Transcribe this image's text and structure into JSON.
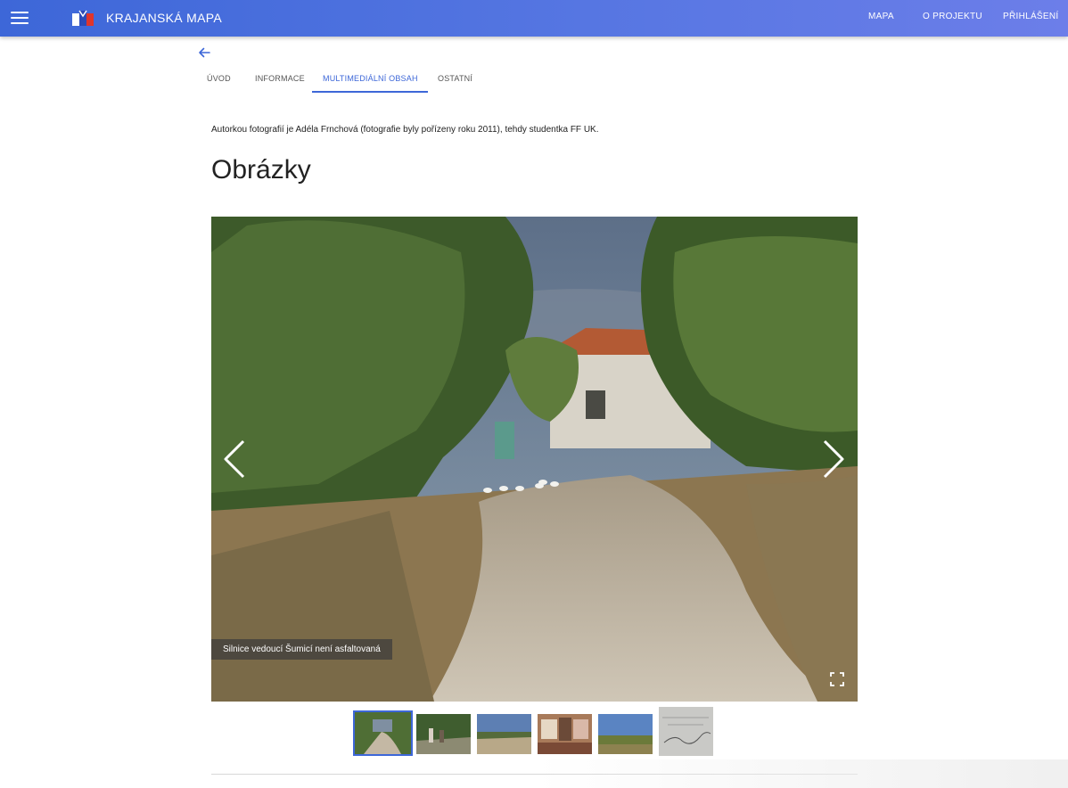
{
  "header": {
    "title": "KRAJANSKÁ MAPA",
    "menu_icon": "hamburger-menu-icon",
    "logo": "app-logo",
    "nav": [
      {
        "label": "MAPA"
      },
      {
        "label": "O PROJEKTU"
      },
      {
        "label": "PŘIHLÁŠENÍ"
      }
    ],
    "color_start": "#3d67d8",
    "color_end": "#6c7ee9"
  },
  "back_icon": "arrow-left-icon",
  "tabs": [
    {
      "label": "ÚVOD",
      "active": false
    },
    {
      "label": "INFORMACE",
      "active": false
    },
    {
      "label": "MULTIMEDIÁLNÍ OBSAH",
      "active": true
    },
    {
      "label": "OSTATNÍ",
      "active": false
    }
  ],
  "content": {
    "author_note": "Autorkou fotografií je Adéla Frnchová (fotografie byly pořízeny roku 2011), tehdy studentka FF UK.",
    "heading": "Obrázky"
  },
  "gallery": {
    "caption": "Silnice vedoucí Šumicí není asfaltovaná",
    "prev_icon": "chevron-left-icon",
    "next_icon": "chevron-right-icon",
    "fullscreen_icon": "fullscreen-icon",
    "active_index": 0,
    "thumbnail_count": 6
  }
}
